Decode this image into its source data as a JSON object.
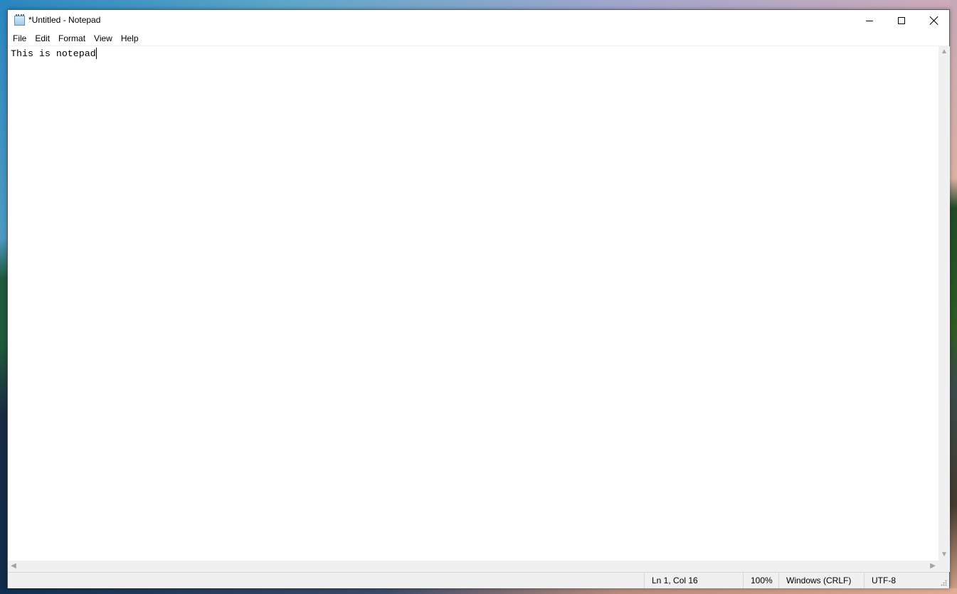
{
  "window": {
    "title": "*Untitled - Notepad",
    "app_icon": "notepad-icon",
    "controls": {
      "minimize_icon": "minimize-icon",
      "maximize_icon": "maximize-icon",
      "close_icon": "close-icon"
    }
  },
  "menubar": {
    "items": [
      {
        "label": "File"
      },
      {
        "label": "Edit"
      },
      {
        "label": "Format"
      },
      {
        "label": "View"
      },
      {
        "label": "Help"
      }
    ]
  },
  "editor": {
    "text": "This is notepad"
  },
  "scrollbars": {
    "up": "▲",
    "down": "▼",
    "left": "◀",
    "right": "▶"
  },
  "statusbar": {
    "position": "Ln 1, Col 16",
    "zoom": "100%",
    "line_ending": "Windows (CRLF)",
    "encoding": "UTF-8"
  }
}
